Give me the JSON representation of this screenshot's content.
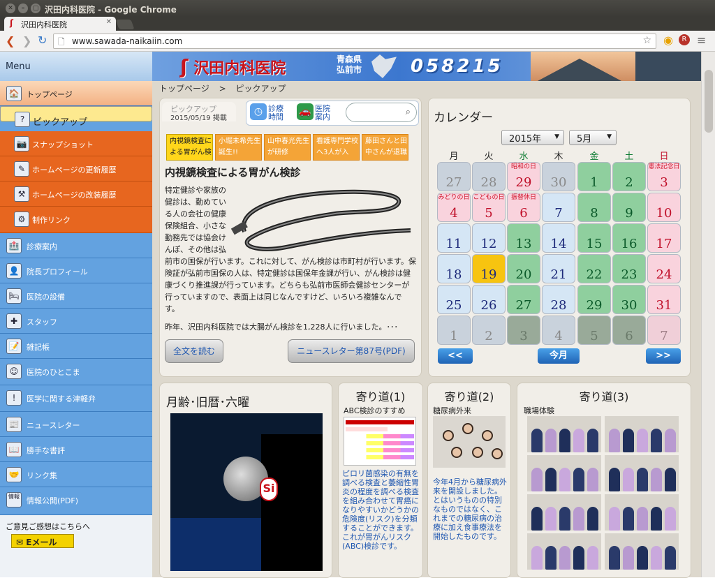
{
  "window": {
    "title": "沢田内科医院 - Google Chrome",
    "tab_title": "沢田内科医院",
    "url": "www.sawada-naikaiin.com"
  },
  "banner": {
    "logo": "沢田内科医院",
    "pref_top": "青森県",
    "pref_bottom": "弘前市",
    "phone": "058215"
  },
  "breadcrumb": {
    "home": "トップページ",
    "sep": ">",
    "current": "ピックアップ"
  },
  "sidebar": {
    "title": "Menu",
    "items": [
      {
        "label": "トップページ",
        "icon": "🏠"
      },
      {
        "label": "ピックアップ",
        "icon": "?"
      },
      {
        "label": "スナップショット",
        "icon": "📷"
      },
      {
        "label": "ホームページの更新履歴",
        "icon": "✎"
      },
      {
        "label": "ホームページの改装履歴",
        "icon": "⚒"
      },
      {
        "label": "制作リンク",
        "icon": "⚙"
      },
      {
        "label": "診療案内",
        "icon": "🏥"
      },
      {
        "label": "院長プロフィール",
        "icon": "👤"
      },
      {
        "label": "医院の設備",
        "icon": "🛏"
      },
      {
        "label": "スタッフ",
        "icon": "✚"
      },
      {
        "label": "雑記帳",
        "icon": "📝"
      },
      {
        "label": "医院のひとこま",
        "icon": "☺"
      },
      {
        "label": "医学に関する津軽弁",
        "icon": "!"
      },
      {
        "label": "ニュースレター",
        "icon": "📰"
      },
      {
        "label": "勝手な書評",
        "icon": "📖"
      },
      {
        "label": "リンク集",
        "icon": "🤝"
      },
      {
        "label": "情報公開(PDF)",
        "icon": "情報"
      }
    ],
    "opinion": "ご意見ご感想はこちらへ",
    "email_label": "Eメール"
  },
  "pickup": {
    "label": "ピックアップ",
    "date": "2015/05/19 掲載",
    "nav_hours": [
      "診療",
      "時間"
    ],
    "nav_guide": [
      "医院",
      "案内"
    ],
    "news_tabs": [
      {
        "label": "内視鏡検査による胃がん検"
      },
      {
        "label": "小堀未希先生誕生!!"
      },
      {
        "label": "山中春光先生が研修"
      },
      {
        "label": "看護専門学校へ3人が入"
      },
      {
        "label": "藤田さんと田中さんが退職"
      }
    ],
    "title": "内視鏡検査による胃がん検診",
    "body_narrow": [
      "特定健診や家族の",
      "健診は、勤めてい",
      "る人の会社の健康",
      "保険組合、小さな",
      "勤務先では協会け",
      "んぽ、その他は弘"
    ],
    "body_wide": "前市の国保が行います。これに対して、がん検診は市町村が行います。保険証が弘前市国保の人は、特定健診は国保年金課が行い、がん検診は健康づくり推進課が行っています。どちらも弘前市医師会健診センターが行っていますので、表面上は同じなんですけど、いろいろ複雑なんです。",
    "more": "昨年、沢田内科医院では大腸がん検診を1,228人に行いました。･･･",
    "read_all": "全文を読む",
    "newsletter": "ニュースレター第87号(PDF)"
  },
  "calendar": {
    "title": "カレンダー",
    "year": "2015年",
    "month": "5月",
    "weekdays": [
      "月",
      "火",
      "水",
      "木",
      "金",
      "土",
      "日"
    ],
    "weeks": [
      [
        {
          "d": "27",
          "t": "dim"
        },
        {
          "d": "28",
          "t": "dim"
        },
        {
          "d": "29",
          "t": "holi",
          "h": "昭和の日"
        },
        {
          "d": "30",
          "t": "dim"
        },
        {
          "d": "1",
          "t": "sat"
        },
        {
          "d": "2",
          "t": "sat"
        },
        {
          "d": "3",
          "t": "sun",
          "h": "憲法記念日"
        }
      ],
      [
        {
          "d": "4",
          "t": "holi",
          "h": "みどりの日"
        },
        {
          "d": "5",
          "t": "holi",
          "h": "こどもの日"
        },
        {
          "d": "6",
          "t": "holi",
          "h": "振替休日"
        },
        {
          "d": "7",
          "t": "wk"
        },
        {
          "d": "8",
          "t": "sat"
        },
        {
          "d": "9",
          "t": "sat"
        },
        {
          "d": "10",
          "t": "sun"
        }
      ],
      [
        {
          "d": "11",
          "t": "wk"
        },
        {
          "d": "12",
          "t": "wk"
        },
        {
          "d": "13",
          "t": "sat"
        },
        {
          "d": "14",
          "t": "wk"
        },
        {
          "d": "15",
          "t": "sat"
        },
        {
          "d": "16",
          "t": "sat"
        },
        {
          "d": "17",
          "t": "sun"
        }
      ],
      [
        {
          "d": "18",
          "t": "wk"
        },
        {
          "d": "19",
          "t": "today"
        },
        {
          "d": "20",
          "t": "sat"
        },
        {
          "d": "21",
          "t": "wk"
        },
        {
          "d": "22",
          "t": "sat"
        },
        {
          "d": "23",
          "t": "sat"
        },
        {
          "d": "24",
          "t": "sun"
        }
      ],
      [
        {
          "d": "25",
          "t": "wk"
        },
        {
          "d": "26",
          "t": "wk"
        },
        {
          "d": "27",
          "t": "sat"
        },
        {
          "d": "28",
          "t": "wk"
        },
        {
          "d": "29",
          "t": "sat"
        },
        {
          "d": "30",
          "t": "sat"
        },
        {
          "d": "31",
          "t": "sun"
        }
      ],
      [
        {
          "d": "1",
          "t": "dim"
        },
        {
          "d": "2",
          "t": "dim"
        },
        {
          "d": "3",
          "t": "dimsat"
        },
        {
          "d": "4",
          "t": "dim"
        },
        {
          "d": "5",
          "t": "dimsat"
        },
        {
          "d": "6",
          "t": "dimsat"
        },
        {
          "d": "7",
          "t": "dimsun"
        }
      ]
    ],
    "prev": "<<",
    "today": "今月",
    "next": ">>"
  },
  "moon": {
    "title": "月齢･旧暦･六曜",
    "balloon_mark": "Si"
  },
  "yori1": {
    "title": "寄り道(1)",
    "subtitle": "ABC検診のすすめ",
    "text": "ピロリ菌感染の有無を調べる検査と萎縮性胃炎の程度を調べる検査を組み合わせて胃癌になりやすいかどうかの危険度(リスク)を分類することができます。これが胃がんリスク(ABC)検診です。"
  },
  "yori2": {
    "title": "寄り道(2)",
    "subtitle": "糖尿病外来",
    "text": "今年4月から糖尿病外来を開設しました。とはいうものの特別なものではなく、これまでの糖尿病の治療に加え食事療法を開始したものです。"
  },
  "yori3": {
    "title": "寄り道(3)",
    "subtitle": "職場体験"
  },
  "colors": {
    "accent_orange": "#e7661f",
    "sidebar_blue": "#63a2e0",
    "link_blue": "#1e56b0"
  }
}
